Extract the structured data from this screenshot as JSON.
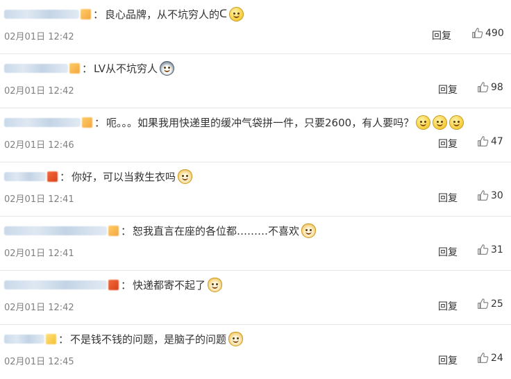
{
  "comments": [
    {
      "user_width": 108,
      "badge": "gold",
      "text": "良心品牌，从不坑穷人的",
      "trail": "ᑕ",
      "emojis": [
        "laugh"
      ],
      "time": "02月01日 12:42",
      "reply": "回复",
      "likes": "490"
    },
    {
      "user_width": 92,
      "badge": "gold",
      "text": "LV从不坑穷人",
      "emojis": [
        "husky"
      ],
      "time": "02月01日 12:42",
      "reply": "回复",
      "likes": "98"
    },
    {
      "user_width": 110,
      "badge": "gold",
      "text": "呃。。。如果我用快递里的缓冲气袋拼一件，只要2600，有人要吗？",
      "emojis": [
        "smile",
        "smile",
        "smile"
      ],
      "time": "02月01日 12:46",
      "reply": "回复",
      "likes": "47"
    },
    {
      "user_width": 60,
      "badge": "red",
      "text": "你好，可以当救生衣吗",
      "emojis": [
        "doge"
      ],
      "time": "02月01日 12:41",
      "reply": "回复",
      "likes": "30"
    },
    {
      "user_width": 148,
      "badge": "gold",
      "text": "恕我直言在座的各位都………不喜欢",
      "emojis": [
        "doge"
      ],
      "time": "02月01日 12:41",
      "reply": "回复",
      "likes": "31"
    },
    {
      "user_width": 148,
      "badge": "red",
      "text": "快递都寄不起了",
      "emojis": [
        "doge"
      ],
      "time": "02月01日 12:42",
      "reply": "回复",
      "likes": "25"
    },
    {
      "user_width": 58,
      "badge": "yellow",
      "text": "不是钱不钱的问题，是脑子的问题",
      "emojis": [
        "doge"
      ],
      "time": "02月01日 12:45",
      "reply": "回复",
      "likes": "24"
    }
  ],
  "colon": "：",
  "icons": {
    "like": "thumbs-up-icon"
  },
  "colors": {
    "text": "#333333",
    "time": "#808080",
    "divider": "#e6e6e6"
  }
}
